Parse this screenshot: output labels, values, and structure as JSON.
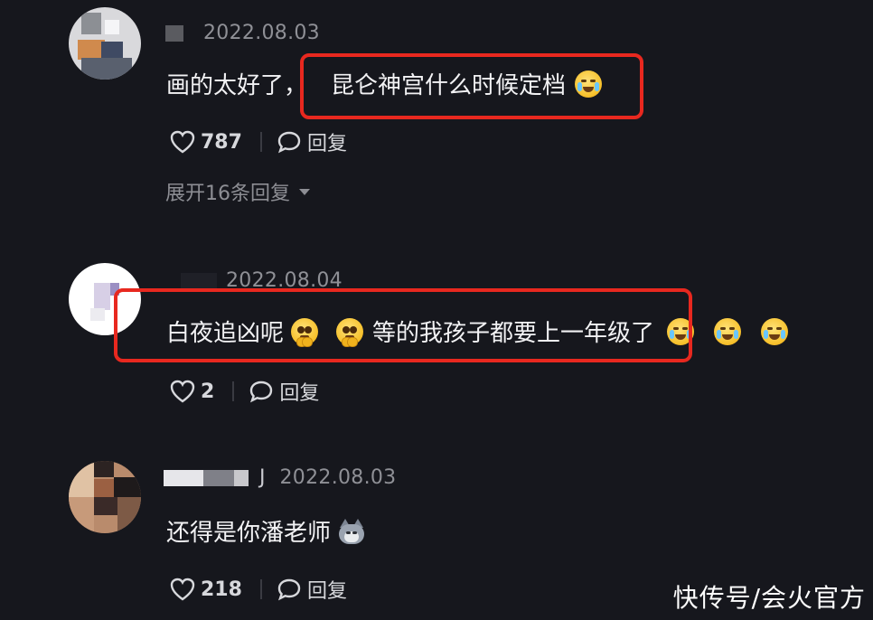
{
  "comments": [
    {
      "date": "2022.08.03",
      "text_prefix": "画的太好了，",
      "text_highlight": "昆仑神宫什么时候定档",
      "likes": "787",
      "reply_label": "回复",
      "expand_label": "展开16条回复"
    },
    {
      "date": "2022.08.04",
      "text_a": "白夜追凶呢",
      "text_b": "等的我孩子都要上一年级了",
      "likes": "2",
      "reply_label": "回复"
    },
    {
      "username_tail": "J",
      "date": "2022.08.03",
      "text": "还得是你潘老师",
      "likes": "218",
      "reply_label": "回复"
    }
  ],
  "watermark": "快传号/会火官方",
  "colors": {
    "background": "#16171d",
    "highlight_box": "#e8281f",
    "secondary_text": "#8f9096"
  }
}
